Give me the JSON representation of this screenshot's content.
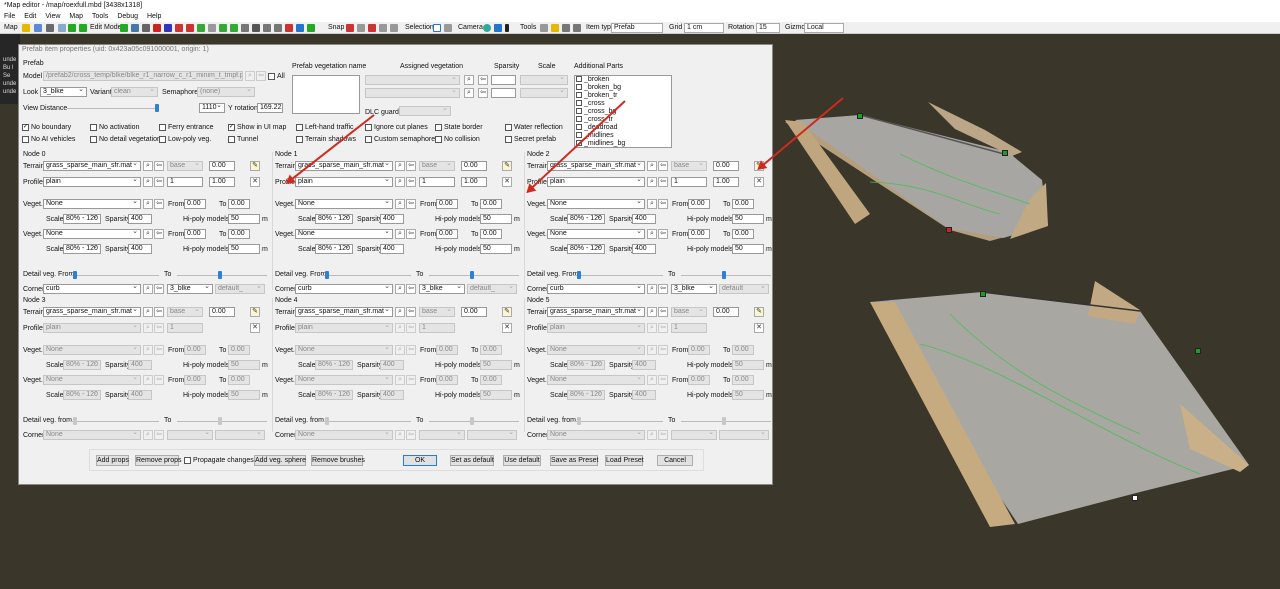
{
  "window": {
    "title": "*Map editor - /map/roexfull.mbd [3438x1318]"
  },
  "menu": [
    "File",
    "Edit",
    "View",
    "Map",
    "Tools",
    "Debug",
    "Help"
  ],
  "toolbar": {
    "map": "Map",
    "edit_mode": "Edit Mode",
    "snap": "Snap",
    "selection": "Selection",
    "camera": "Camera",
    "tools": "Tools",
    "item_type_label": "Item type",
    "item_type": "Prefab",
    "grid_label": "Grid",
    "grid": "1 cm",
    "rotation_label": "Rotation",
    "rotation": "15",
    "gizmo_label": "Gizmo",
    "gizmo": "Local"
  },
  "console": [
    "unde",
    "Bu l",
    "Se",
    "unde",
    "unde"
  ],
  "dialog": {
    "title": "Prefab item properties (uid: 0x423a05c091000001, origin: 1)",
    "prefab_header": "Prefab",
    "model_label": "Model",
    "model": "/prefab2/cross_temp/blke/blke_r1_narrow_c_r1_minim_t_tmpl.ppd",
    "all_label": "All",
    "look_label": "Look",
    "look": "3_blke",
    "variant_label": "Variant",
    "variant": "clean",
    "semaphores_label": "Semaphores",
    "semaphores": "(none)",
    "view_distance_label": "View Distance",
    "view_distance": "1110",
    "y_rotation_label": "Y rotation",
    "y_rotation": "169.222",
    "prefab_vegetation_label": "Prefab vegetation name",
    "assigned_vegetation_label": "Assigned vegetation",
    "sparsity_label": "Sparsity",
    "scale_label": "Scale",
    "dlc_guard_label": "DLC guard:",
    "additional_parts_label": "Additional Parts",
    "additional_parts": [
      "_broken",
      "_broken_bg",
      "_broken_tr",
      "_cross",
      "_cross_bg",
      "_cross_tr",
      "_deadroad",
      "_midlines",
      "_midlines_bg"
    ],
    "flags": [
      {
        "label": "No boundary",
        "checked": true
      },
      {
        "label": "No activation",
        "checked": false
      },
      {
        "label": "Ferry entrance",
        "checked": false
      },
      {
        "label": "Show in UI map",
        "checked": true
      },
      {
        "label": "Left-hand traffic",
        "checked": false
      },
      {
        "label": "Ignore cut planes",
        "checked": false
      },
      {
        "label": "State border",
        "checked": false
      },
      {
        "label": "Water reflection",
        "checked": false
      },
      {
        "label": "No AI vehicles",
        "checked": false
      },
      {
        "label": "No detail vegetation",
        "checked": false
      },
      {
        "label": "Low-poly veg.",
        "checked": false
      },
      {
        "label": "Tunnel",
        "checked": false
      },
      {
        "label": "Terrain shadows",
        "checked": false
      },
      {
        "label": "Custom semaphores",
        "checked": false
      },
      {
        "label": "No collision",
        "checked": false
      },
      {
        "label": "Secret prefab",
        "checked": false
      }
    ],
    "labels": {
      "terrain": "Terrain",
      "profile": "Profile",
      "veget": "Veget.",
      "scale": "Scale",
      "sparsity": "Sparsity",
      "from": "From",
      "to": "To",
      "hipoly": "Hi-poly models",
      "m": "m",
      "detail_from_a": "Detail veg. From",
      "detail_from_b": "Detail veg. from",
      "to2": "To",
      "corner": "Corner"
    },
    "nodes": [
      {
        "name": "Node 0",
        "active": true,
        "terrain": "grass_sparse_main_sfr.mat",
        "terrain_base": "base",
        "terrain_val": "0.00",
        "profile": "plain",
        "p1": "1",
        "p2": "1.00",
        "veg1": "None",
        "from1": "0.00",
        "to1": "0.00",
        "scale1": "80% - 120",
        "spars1": "400",
        "hp1": "50",
        "veg2": "None",
        "from2": "0.00",
        "to2": "0.00",
        "scale2": "80% - 120",
        "spars2": "400",
        "hp2": "50",
        "corner": "curb",
        "corner2": "3_blke",
        "corner3": "default_"
      },
      {
        "name": "Node 1",
        "active": true,
        "terrain": "grass_sparse_main_sfr.mat",
        "terrain_base": "base",
        "terrain_val": "0.00",
        "profile": "plain",
        "p1": "1",
        "p2": "1.00",
        "veg1": "None",
        "from1": "0.00",
        "to1": "0.00",
        "scale1": "80% - 120",
        "spars1": "400",
        "hp1": "50",
        "veg2": "None",
        "from2": "0.00",
        "to2": "0.00",
        "scale2": "80% - 120",
        "spars2": "400",
        "hp2": "50",
        "corner": "curb",
        "corner2": "3_blke",
        "corner3": "default_"
      },
      {
        "name": "Node 2",
        "active": true,
        "terrain": "grass_sparse_main_sfr.mat",
        "terrain_base": "base",
        "terrain_val": "0.00",
        "profile": "plain",
        "p1": "1",
        "p2": "1.00",
        "veg1": "None",
        "from1": "0.00",
        "to1": "0.00",
        "scale1": "80% - 120",
        "spars1": "400",
        "hp1": "50",
        "veg2": "None",
        "from2": "0.00",
        "to2": "0.00",
        "scale2": "80% - 120",
        "spars2": "400",
        "hp2": "50",
        "corner": "curb",
        "corner2": "3_blke",
        "corner3": "default"
      },
      {
        "name": "Node 3",
        "active": false,
        "terrain": "grass_sparse_main_sfr.mat",
        "terrain_base": "base",
        "terrain_val": "0.00",
        "profile": "plain",
        "p1": "1",
        "p2": "",
        "veg1": "None",
        "from1": "0.00",
        "to1": "0.00",
        "scale1": "80% - 120",
        "spars1": "400",
        "hp1": "50",
        "veg2": "None",
        "from2": "0.00",
        "to2": "0.00",
        "scale2": "80% - 120",
        "spars2": "400",
        "hp2": "50",
        "corner": "None",
        "corner2": "",
        "corner3": ""
      },
      {
        "name": "Node 4",
        "active": false,
        "terrain": "grass_sparse_main_sfr.mat",
        "terrain_base": "base",
        "terrain_val": "0.00",
        "profile": "plain",
        "p1": "1",
        "p2": "",
        "veg1": "None",
        "from1": "0.00",
        "to1": "0.00",
        "scale1": "80% - 120",
        "spars1": "400",
        "hp1": "50",
        "veg2": "None",
        "from2": "0.00",
        "to2": "0.00",
        "scale2": "80% - 120",
        "spars2": "400",
        "hp2": "50",
        "corner": "None",
        "corner2": "",
        "corner3": ""
      },
      {
        "name": "Node 5",
        "active": false,
        "terrain": "grass_sparse_main_sfr.mat",
        "terrain_base": "base",
        "terrain_val": "0.00",
        "profile": "plain",
        "p1": "1",
        "p2": "",
        "veg1": "None",
        "from1": "0.00",
        "to1": "0.00",
        "scale1": "80% - 120",
        "spars1": "400",
        "hp1": "50",
        "veg2": "None",
        "from2": "0.00",
        "to2": "0.00",
        "scale2": "80% - 120",
        "spars2": "400",
        "hp2": "50",
        "corner": "None",
        "corner2": "",
        "corner3": ""
      }
    ],
    "buttons": {
      "add_props": "Add props",
      "remove_props": "Remove props",
      "propagate": "Propagate changes",
      "add_veg_sphere": "Add veg. sphere",
      "remove_brushes": "Remove brushes",
      "ok": "OK",
      "set_default": "Set as default",
      "use_default": "Use default",
      "save_preset": "Save as Preset",
      "load_preset": "Load Preset",
      "cancel": "Cancel"
    }
  }
}
